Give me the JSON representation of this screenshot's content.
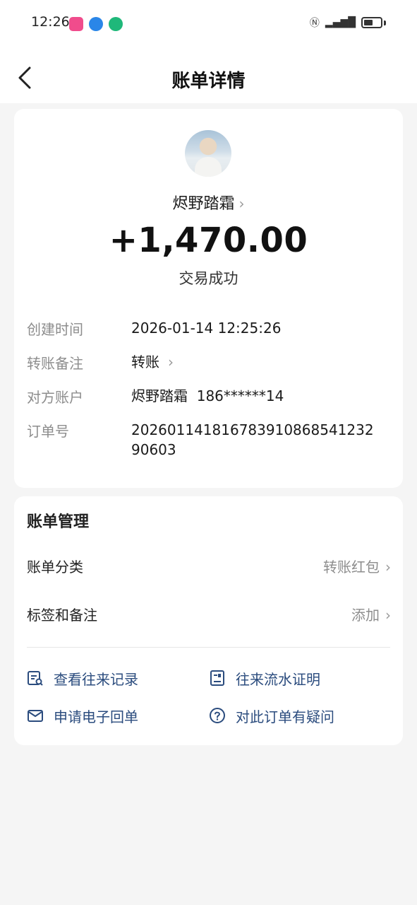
{
  "status_bar": {
    "time": "12:26"
  },
  "header": {
    "title": "账单详情"
  },
  "transaction": {
    "payee": "烬野踏霜",
    "amount": "+1,470.00",
    "status": "交易成功"
  },
  "details": [
    {
      "label": "创建时间",
      "value": "2026-01-14 12:25:26"
    },
    {
      "label": "转账备注",
      "value": "转账"
    },
    {
      "label": "对方账户",
      "value": "烬野踏霜  186******14"
    },
    {
      "label": "订单号",
      "value": "20260114181678391086854123290603"
    }
  ],
  "management": {
    "title": "账单管理",
    "rows": [
      {
        "label": "账单分类",
        "value": "转账红包"
      },
      {
        "label": "标签和备注",
        "value": "添加"
      }
    ],
    "actions": [
      {
        "label": "查看往来记录",
        "icon": "record-list-icon"
      },
      {
        "label": "往来流水证明",
        "icon": "statement-proof-icon"
      },
      {
        "label": "申请电子回单",
        "icon": "mail-icon"
      },
      {
        "label": "对此订单有疑问",
        "icon": "question-icon"
      }
    ]
  },
  "colors": {
    "accent": "#2b4c7e",
    "muted": "#8d8d8d",
    "background": "#f5f5f5"
  }
}
